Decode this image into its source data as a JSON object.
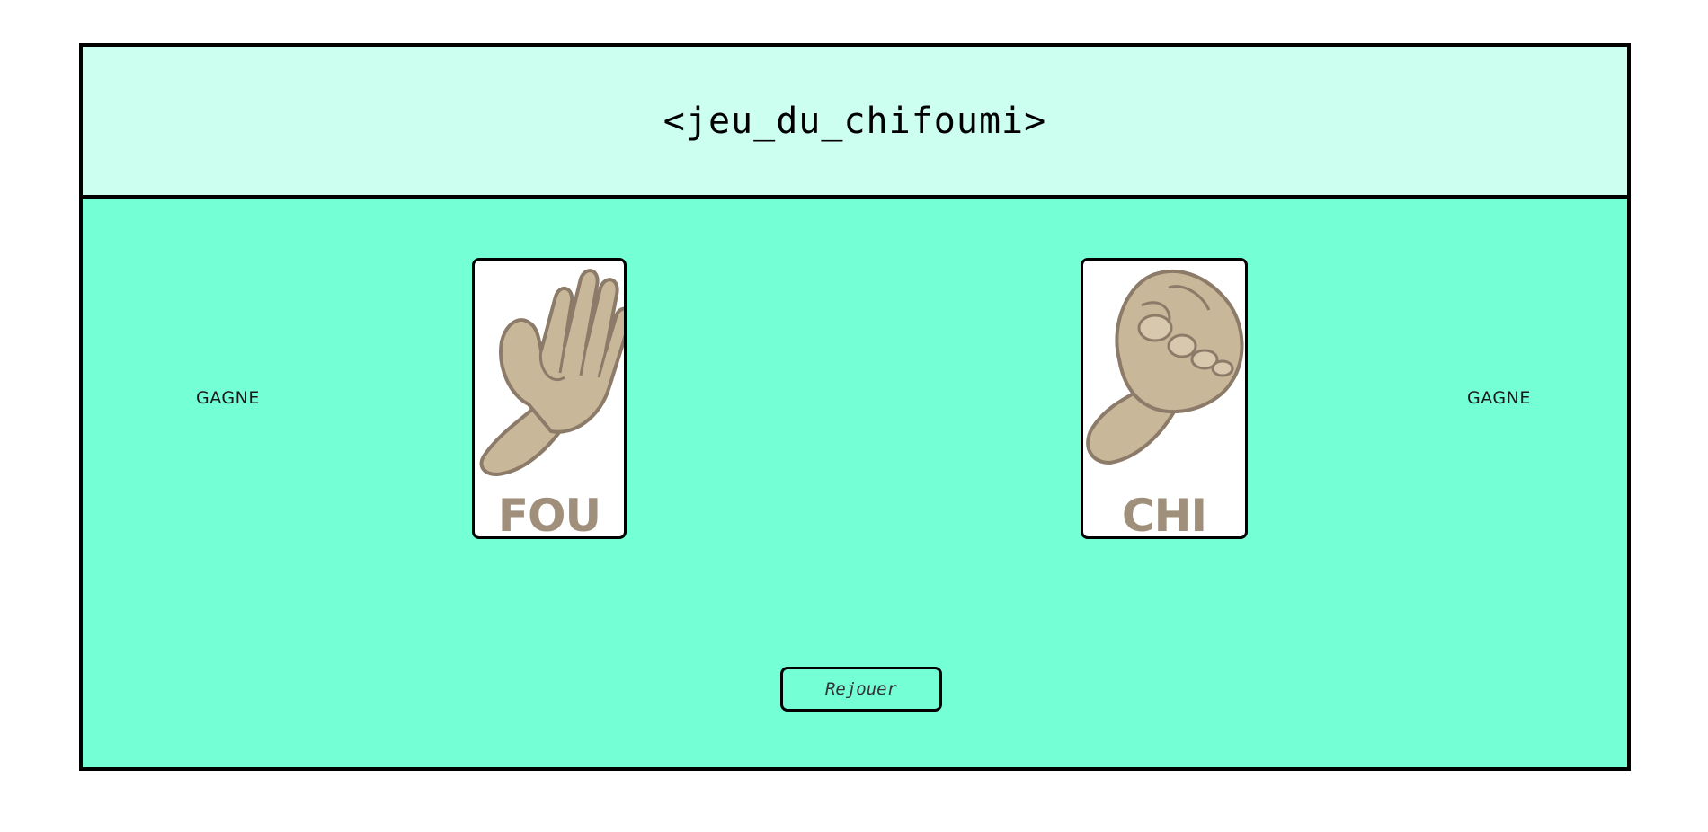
{
  "game": {
    "title": "<jeu_du_chifoumi>",
    "player_left": {
      "result": "GAGNE",
      "card_label": "FOU",
      "hand": "open-hand-paper"
    },
    "player_right": {
      "result": "GAGNE",
      "card_label": "CHI",
      "hand": "fist-rock"
    },
    "replay_label": "Rejouer"
  },
  "colors": {
    "header_bg": "#cdfff0",
    "board_bg": "#74ffd5",
    "hand_fill": "#c9b79a",
    "hand_outline": "#8c7b68",
    "label_color": "#a08f7a"
  }
}
